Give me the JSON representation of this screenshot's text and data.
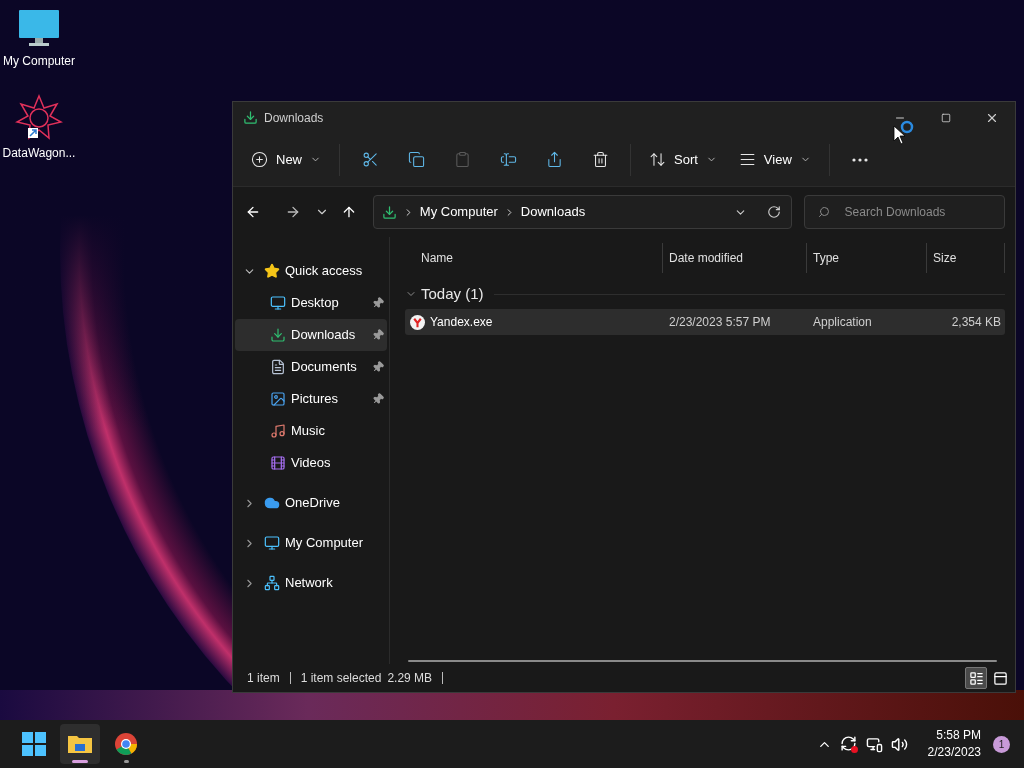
{
  "desktop_icons": [
    {
      "label": "My Computer",
      "kind": "computer"
    },
    {
      "label": "DataWagon...",
      "kind": "shortcut"
    }
  ],
  "window": {
    "title": "Downloads"
  },
  "toolbar": [
    {
      "kind": "new",
      "label": "New",
      "disabled": false
    },
    {
      "kind": "cut",
      "disabled": false
    },
    {
      "kind": "copy",
      "disabled": false
    },
    {
      "kind": "paste",
      "disabled": true
    },
    {
      "kind": "rename",
      "disabled": false
    },
    {
      "kind": "share",
      "disabled": false
    },
    {
      "kind": "delete",
      "disabled": false
    },
    {
      "kind": "sort",
      "label": "Sort",
      "disabled": false
    },
    {
      "kind": "view",
      "label": "View",
      "disabled": false
    },
    {
      "kind": "more",
      "disabled": false
    }
  ],
  "address": {
    "path": [
      "My Computer",
      "Downloads"
    ]
  },
  "search": {
    "placeholder": "Search Downloads"
  },
  "sidebar": {
    "items": [
      {
        "label": "Quick access",
        "kind": "star",
        "selected": false,
        "expanded": true,
        "children": [
          {
            "label": "Desktop",
            "kind": "desktop",
            "selected": false,
            "pinned": true
          },
          {
            "label": "Downloads",
            "kind": "download",
            "selected": true,
            "pinned": true
          },
          {
            "label": "Documents",
            "kind": "documents",
            "selected": false,
            "pinned": true
          },
          {
            "label": "Pictures",
            "kind": "pictures",
            "selected": false,
            "pinned": true
          },
          {
            "label": "Music",
            "kind": "music",
            "selected": false,
            "pinned": false
          },
          {
            "label": "Videos",
            "kind": "videos",
            "selected": false,
            "pinned": false
          }
        ]
      },
      {
        "label": "OneDrive",
        "kind": "cloud",
        "selected": false,
        "expanded": false
      },
      {
        "label": "My Computer",
        "kind": "computer",
        "selected": false,
        "expanded": false
      },
      {
        "label": "Network",
        "kind": "network",
        "selected": false,
        "expanded": false
      }
    ]
  },
  "table": {
    "columns": [
      "Name",
      "Date modified",
      "Type",
      "Size"
    ],
    "groups": [
      {
        "title": "Today (1)",
        "expanded": true,
        "rows": [
          {
            "name": "Yandex.exe",
            "date": "2/23/2023 5:57 PM",
            "type": "Application",
            "size": "2,354 KB",
            "selected": true
          }
        ]
      }
    ]
  },
  "status_bar": {
    "count": "1 item",
    "selection": "1 item selected",
    "size": "2.29 MB",
    "views": [
      {
        "kind": "details",
        "selected": true
      },
      {
        "kind": "preview",
        "selected": false
      }
    ]
  },
  "taskbar": {
    "apps": [
      {
        "kind": "start",
        "selected": false,
        "running": false
      },
      {
        "kind": "explorer",
        "selected": true,
        "running": true
      },
      {
        "kind": "browser",
        "selected": false,
        "running": true
      }
    ],
    "time": "5:58 PM",
    "date": "2/23/2023",
    "notifications": "1"
  }
}
